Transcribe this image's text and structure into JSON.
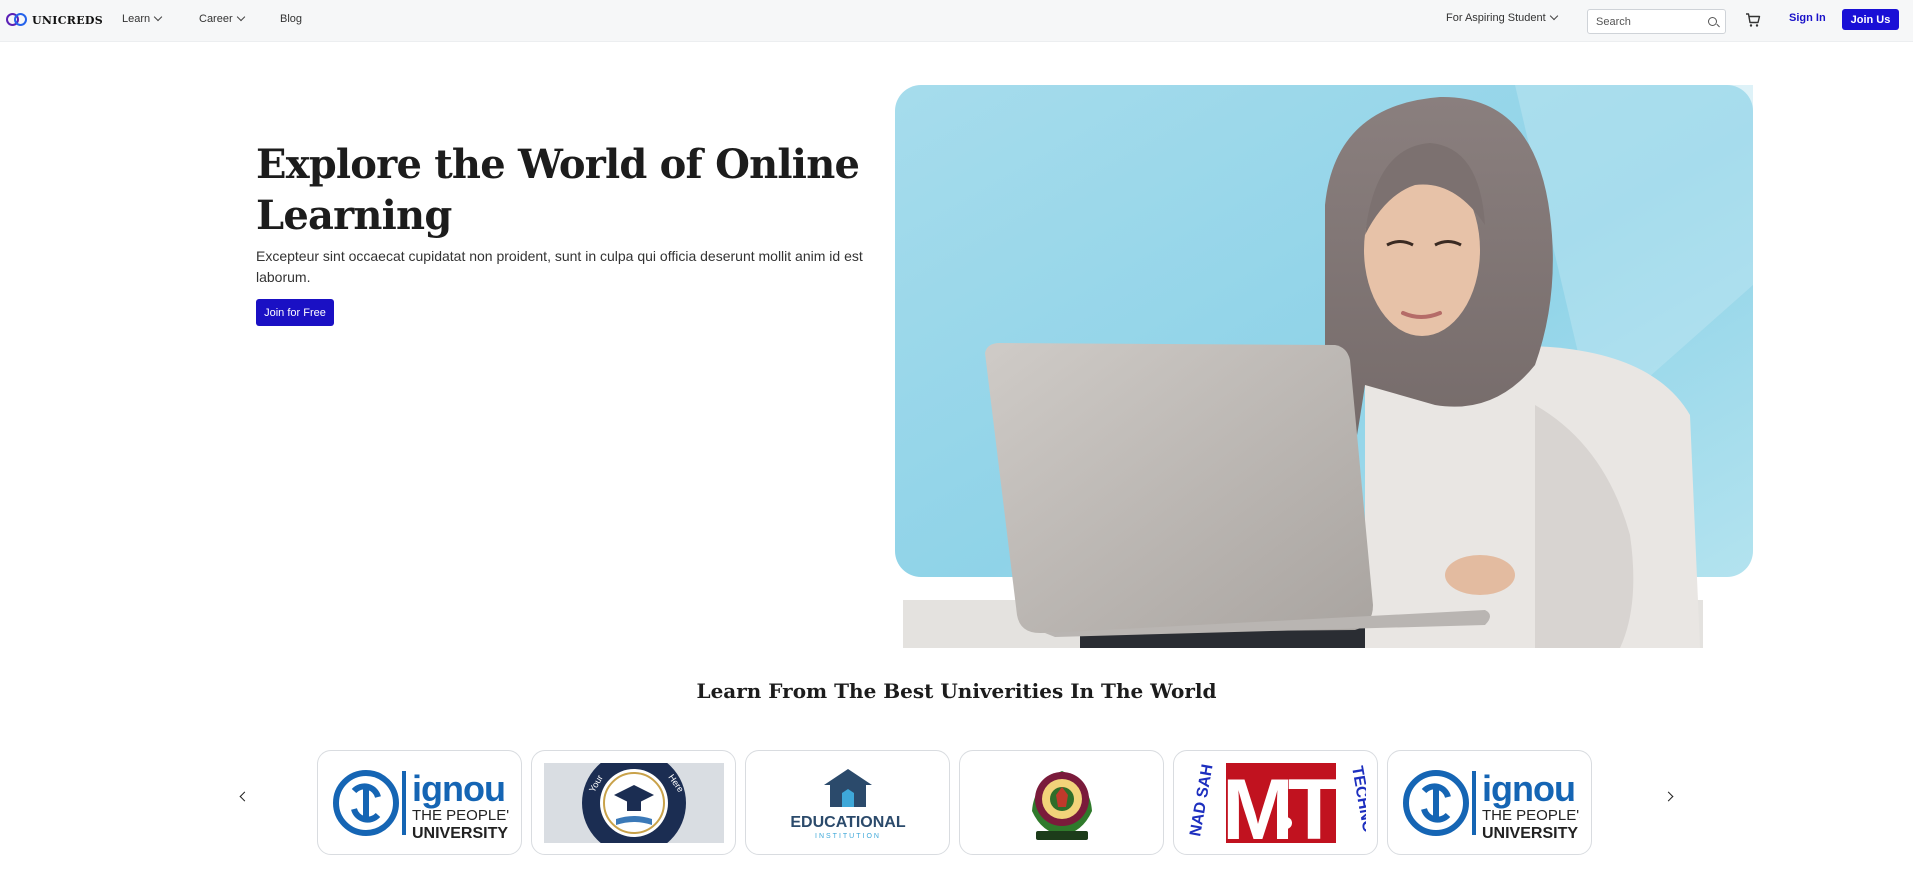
{
  "brand": {
    "name": "UNICREDS"
  },
  "nav": {
    "learn": "Learn",
    "career": "Career",
    "blog": "Blog",
    "audience": "For Aspiring Student",
    "search_placeholder": "Search",
    "signin": "Sign In",
    "joinus": "Join Us"
  },
  "hero": {
    "title": "Explore the World of Online Learning",
    "subtitle": "Excepteur sint occaecat cupidatat non proident, sunt in culpa qui officia deserunt mollit anim id est laborum.",
    "cta": "Join for Free"
  },
  "universities": {
    "title": "Learn From The Best Univerities In The World",
    "logos": [
      {
        "name": "ignou",
        "line1": "ignou",
        "line2": "THE PEOPLE'S",
        "line3": "UNIVERSITY"
      },
      {
        "name": "academy-seal",
        "top": "Your",
        "right": "Here"
      },
      {
        "name": "educational-institution",
        "line1": "EDUCATIONAL",
        "line2": "INSTITUTION"
      },
      {
        "name": "emblem"
      },
      {
        "name": "mit",
        "line1": "M",
        "line2": "T",
        "arc_left": "NAD SAH",
        "arc_right": "TECHNO"
      },
      {
        "name": "ignou",
        "line1": "ignou",
        "line2": "THE PEOPLE'S",
        "line3": "UNIVERSITY"
      }
    ]
  },
  "colors": {
    "primary": "#1a10d6",
    "ignou_blue": "#1565b4",
    "navy": "#1b2d52",
    "mit_red": "#c1121f"
  }
}
